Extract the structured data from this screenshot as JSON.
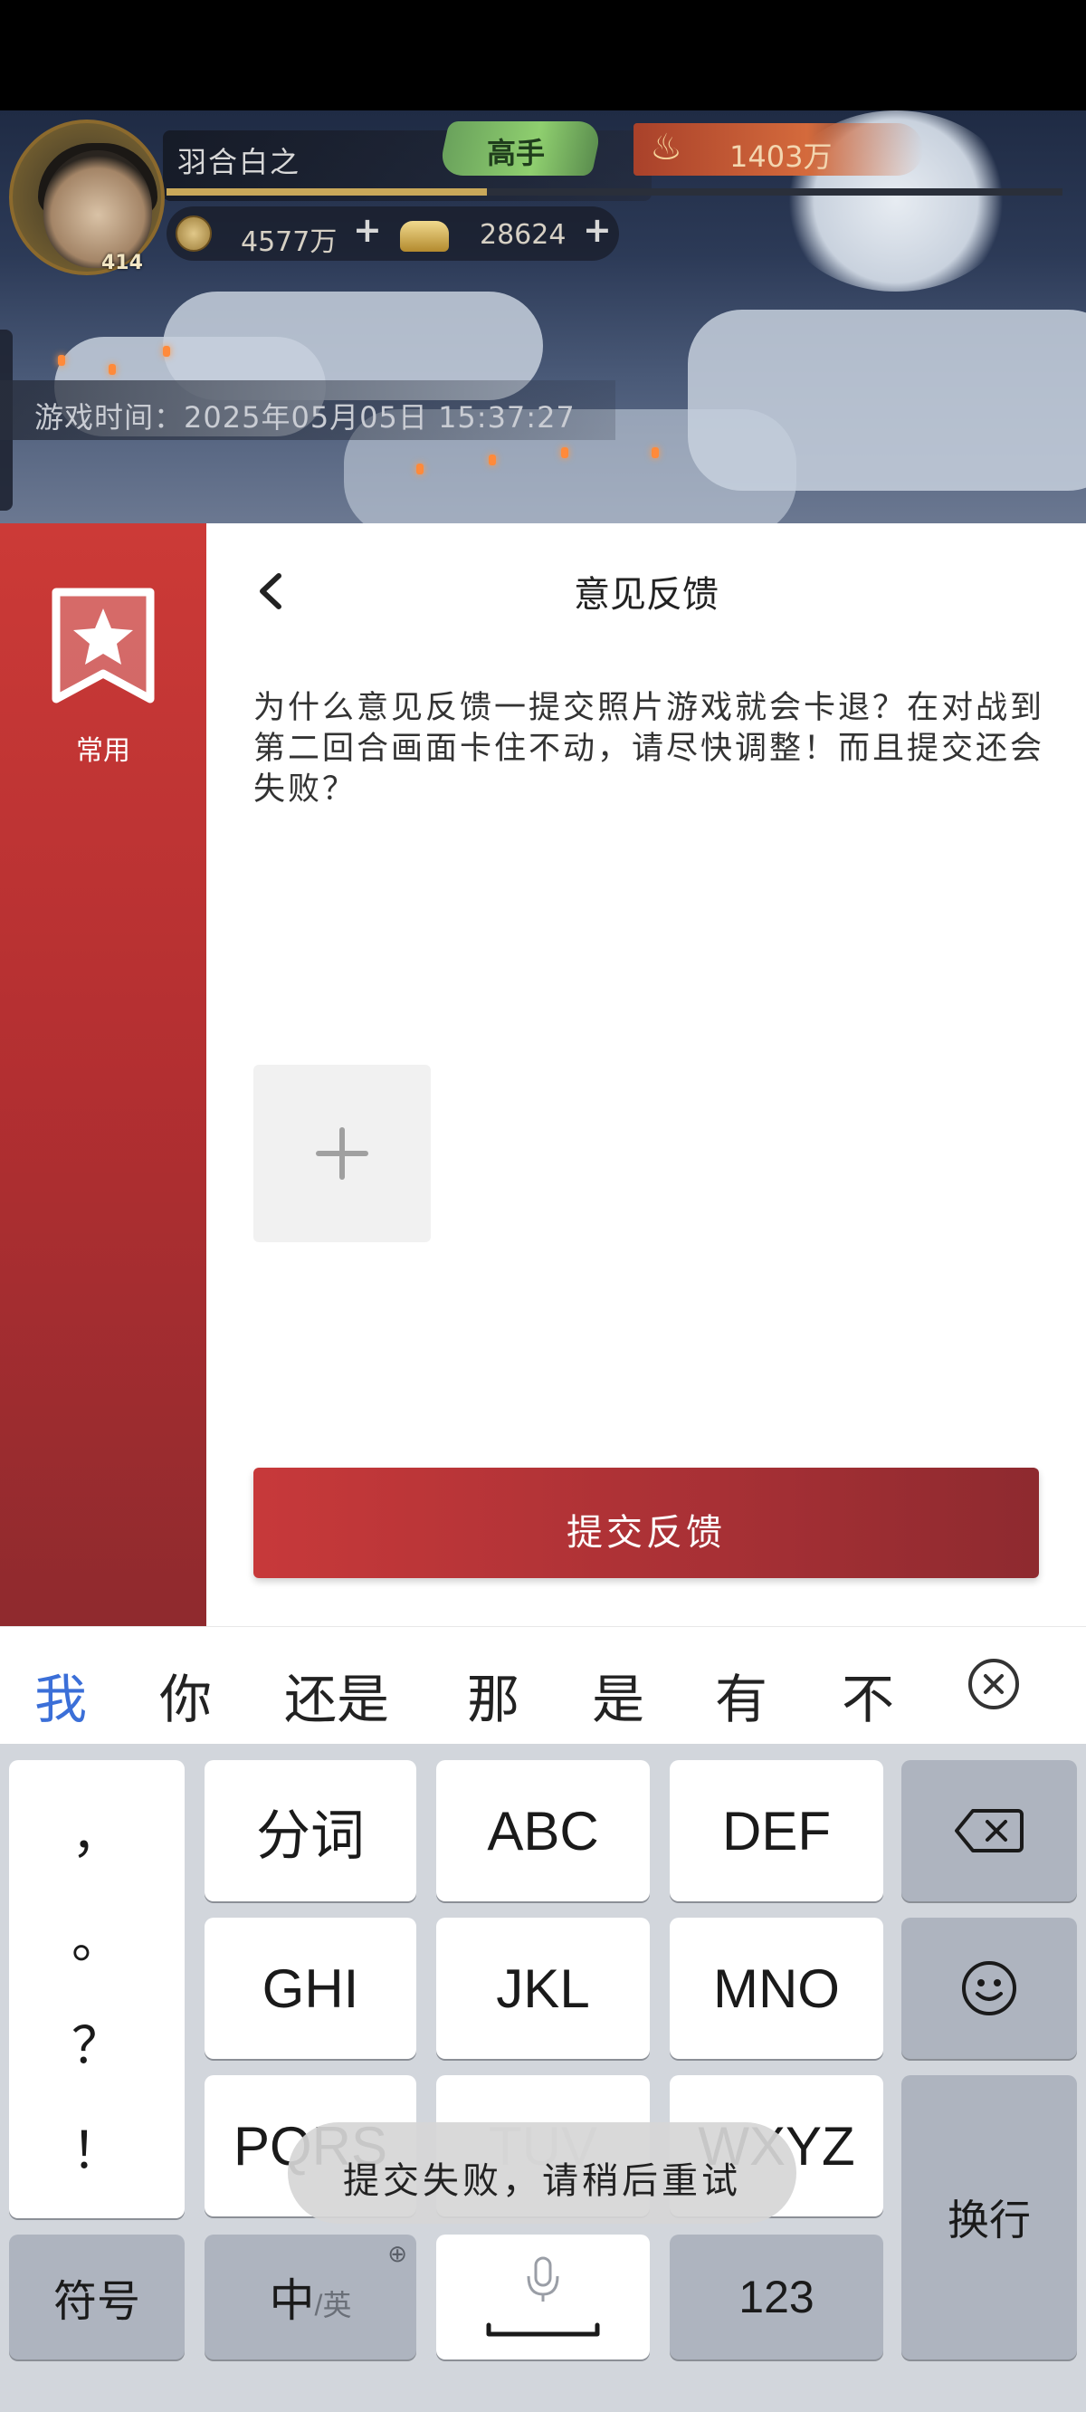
{
  "game_hud": {
    "player_name": "羽合白之",
    "avatar_level": "414",
    "rank": "高手",
    "power": "1403万",
    "coins": "4577万",
    "ingots": "28624",
    "game_time_label": "游戏时间：",
    "game_time_value": "2025年05月05日  15:37:27"
  },
  "sidebar": {
    "items": [
      {
        "label": "常用",
        "icon": "bookmark-star-icon",
        "active": true
      }
    ]
  },
  "feedback": {
    "title": "意见反馈",
    "text": "为什么意见反馈一提交照片游戏就会卡退？在对战到第二回合画面卡住不动，请尽快调整！而且提交还会失败？",
    "submit_label": "提交反馈"
  },
  "keyboard": {
    "candidates": [
      "我",
      "你",
      "还是",
      "那",
      "是",
      "有",
      "不"
    ],
    "highlight_color": "#3b6fd8",
    "punct": [
      "，",
      "。",
      "？",
      "！"
    ],
    "keys": {
      "segment": "分词",
      "abc": "ABC",
      "def": "DEF",
      "ghi": "GHI",
      "jkl": "JKL",
      "mno": "MNO",
      "pqrs": "PQRS",
      "tuv": "TUV",
      "wxyz": "WXYZ",
      "newline": "换行",
      "symbols": "符号",
      "lang_main": "中",
      "lang_sub": "/英",
      "num": "123"
    }
  },
  "toast": {
    "text": "提交失败，请稍后重试"
  },
  "colors": {
    "brand_red": "#c7393a",
    "keyboard_bg": "#d2d6dc"
  }
}
